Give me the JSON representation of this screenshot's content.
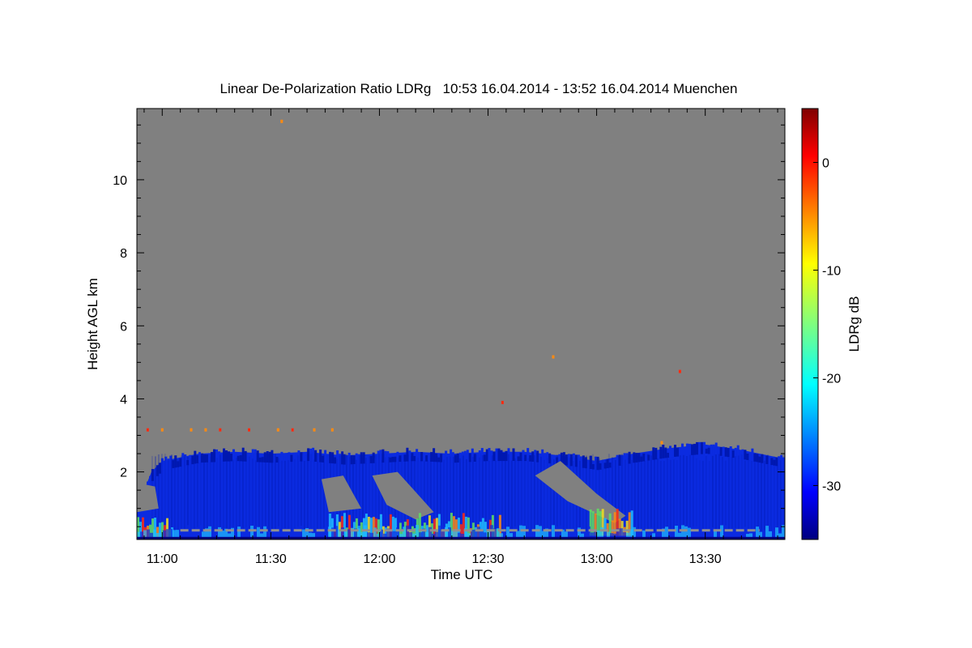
{
  "chart_data": {
    "type": "heatmap",
    "title": "Linear De-Polarization Ratio LDRg   10:53 16.04.2014 - 13:52 16.04.2014 Muenchen",
    "xlabel": "Time UTC",
    "ylabel": "Height AGL km",
    "colorbar_label": "LDRg dB",
    "x_range": [
      "10:53",
      "13:52"
    ],
    "x_ticks": [
      "11:00",
      "11:30",
      "12:00",
      "12:30",
      "13:00",
      "13:30"
    ],
    "y_range": [
      0.15,
      11.95
    ],
    "y_ticks": [
      2,
      4,
      6,
      8,
      10
    ],
    "colorbar_range": [
      -35,
      5
    ],
    "colorbar_ticks": [
      0,
      -10,
      -20,
      -30
    ],
    "colormap": "jet",
    "no_data_color": "#808080",
    "colors": {
      "blue_mid": "#0b2be0",
      "blue_dark": "#0018b0",
      "cyan": "#20c0ff",
      "green": "#5fe060",
      "yellow": "#f0e020",
      "orange": "#ff8a10",
      "red": "#ff2a10",
      "dark_red": "#800000",
      "navy": "#000080"
    },
    "boundary_layer_top_km": [
      [
        "10:53",
        1.0
      ],
      [
        "10:57",
        2.0
      ],
      [
        "11:00",
        2.3
      ],
      [
        "11:10",
        2.5
      ],
      [
        "11:20",
        2.55
      ],
      [
        "11:30",
        2.5
      ],
      [
        "11:40",
        2.55
      ],
      [
        "11:50",
        2.45
      ],
      [
        "12:00",
        2.5
      ],
      [
        "12:10",
        2.55
      ],
      [
        "12:20",
        2.5
      ],
      [
        "12:30",
        2.55
      ],
      [
        "12:40",
        2.55
      ],
      [
        "12:50",
        2.45
      ],
      [
        "13:00",
        2.3
      ],
      [
        "13:10",
        2.5
      ],
      [
        "13:20",
        2.65
      ],
      [
        "13:30",
        2.75
      ],
      [
        "13:40",
        2.6
      ],
      [
        "13:50",
        2.4
      ],
      [
        "13:52",
        2.4
      ]
    ],
    "gaps_in_aerosol_layer": [
      {
        "times": [
          "11:44",
          "11:50",
          "11:55",
          "11:46"
        ],
        "heights_km": [
          1.8,
          1.9,
          1.0,
          0.9
        ]
      },
      {
        "times": [
          "11:58",
          "12:05",
          "12:15",
          "12:10",
          "12:02"
        ],
        "heights_km": [
          1.9,
          2.0,
          0.9,
          0.7,
          1.1
        ]
      },
      {
        "times": [
          "12:43",
          "12:50",
          "13:00",
          "13:08",
          "13:05",
          "12:52"
        ],
        "heights_km": [
          1.9,
          2.3,
          1.4,
          0.8,
          0.6,
          1.2
        ]
      },
      {
        "times": [
          "10:53",
          "10:58",
          "10:59",
          "10:53"
        ],
        "heights_km": [
          1.7,
          1.6,
          1.0,
          0.9
        ]
      }
    ],
    "high_ldr_regions": [
      {
        "time_range": [
          "10:53",
          "11:03"
        ],
        "height_range_km": [
          0.2,
          0.8
        ]
      },
      {
        "time_range": [
          "11:46",
          "12:33"
        ],
        "height_range_km": [
          0.2,
          0.9
        ]
      },
      {
        "time_range": [
          "12:58",
          "13:10"
        ],
        "height_range_km": [
          0.25,
          1.0
        ]
      }
    ],
    "sparse_returns_km": [
      [
        "10:56",
        3.15
      ],
      [
        "11:00",
        3.15
      ],
      [
        "11:08",
        3.15
      ],
      [
        "11:12",
        3.15
      ],
      [
        "11:16",
        3.15
      ],
      [
        "11:24",
        3.15
      ],
      [
        "11:32",
        3.15
      ],
      [
        "11:36",
        3.15
      ],
      [
        "11:42",
        3.15
      ],
      [
        "11:47",
        3.15
      ],
      [
        "11:33",
        11.6
      ],
      [
        "12:48",
        5.15
      ],
      [
        "13:23",
        4.75
      ],
      [
        "12:34",
        3.9
      ],
      [
        "13:18",
        2.8
      ]
    ]
  }
}
